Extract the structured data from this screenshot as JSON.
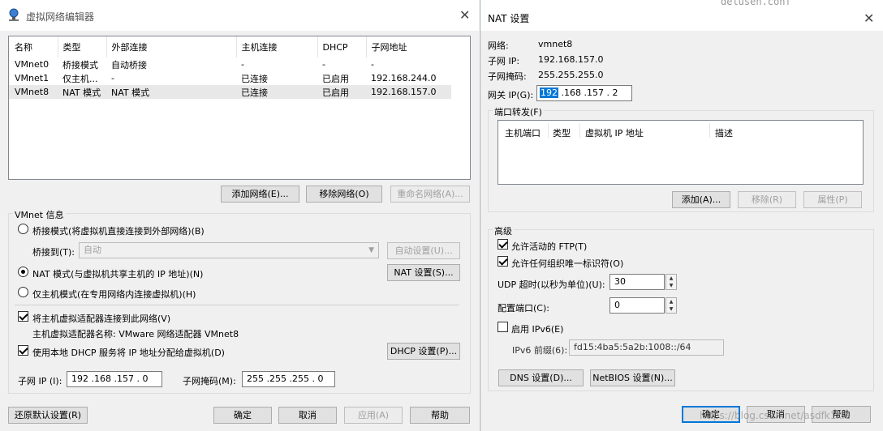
{
  "left": {
    "title": "虚拟网络编辑器",
    "columns": [
      "名称",
      "类型",
      "外部连接",
      "主机连接",
      "DHCP",
      "子网地址"
    ],
    "rows": [
      [
        "VMnet0",
        "桥接模式",
        "自动桥接",
        "-",
        "-",
        "-"
      ],
      [
        "VMnet1",
        "仅主机...",
        "-",
        "已连接",
        "已启用",
        "192.168.244.0"
      ],
      [
        "VMnet8",
        "NAT 模式",
        "NAT 模式",
        "已连接",
        "已启用",
        "192.168.157.0"
      ]
    ],
    "add_network": "添加网络(E)...",
    "remove_network": "移除网络(O)",
    "rename_network": "重命名网络(A)...",
    "vmnet_info": "VMnet 信息",
    "bridge_mode": "桥接模式(将虚拟机直接连接到外部网络)(B)",
    "bridge_to_label": "桥接到(T):",
    "bridge_to_value": "自动",
    "auto_settings": "自动设置(U)...",
    "nat_mode": "NAT 模式(与虚拟机共享主机的 IP 地址)(N)",
    "nat_settings": "NAT 设置(S)...",
    "host_only": "仅主机模式(在专用网络内连接虚拟机)(H)",
    "connect_adapter": "将主机虚拟适配器连接到此网络(V)",
    "adapter_name": "主机虚拟适配器名称: VMware 网络适配器 VMnet8",
    "use_dhcp": "使用本地 DHCP 服务将 IP 地址分配给虚拟机(D)",
    "dhcp_settings": "DHCP 设置(P)...",
    "subnet_ip_label": "子网 IP (I):",
    "subnet_ip": "192 .168 .157 . 0",
    "subnet_mask_label": "子网掩码(M):",
    "subnet_mask": "255 .255 .255 . 0",
    "restore_defaults": "还原默认设置(R)",
    "ok": "确定",
    "cancel": "取消",
    "apply": "应用(A)",
    "help": "帮助"
  },
  "right": {
    "title": "NAT 设置",
    "bg_text": "delusen.conf",
    "network_label": "网络:",
    "network_value": "vmnet8",
    "subnet_ip_label": "子网 IP:",
    "subnet_ip_value": "192.168.157.0",
    "subnet_mask_label": "子网掩码:",
    "subnet_mask_value": "255.255.255.0",
    "gateway_label": "网关 IP(G):",
    "gateway_first": "192",
    "gateway_rest": " .168 .157 . 2",
    "port_forward": "端口转发(F)",
    "pf_columns": [
      "主机端口",
      "类型",
      "虚拟机 IP 地址",
      "描述"
    ],
    "add": "添加(A)...",
    "remove": "移除(R)",
    "properties": "属性(P)",
    "advanced": "高级",
    "allow_ftp": "允许活动的 FTP(T)",
    "allow_org_id": "允许任何组织唯一标识符(O)",
    "udp_timeout_label": "UDP 超时(以秒为单位)(U):",
    "udp_timeout": "30",
    "config_port_label": "配置端口(C):",
    "config_port": "0",
    "enable_ipv6": "启用 IPv6(E)",
    "ipv6_prefix_label": "IPv6 前缀(6):",
    "ipv6_prefix": "fd15:4ba5:5a2b:1008::/64",
    "dns_settings": "DNS 设置(D)...",
    "netbios_settings": "NetBIOS 设置(N)...",
    "ok": "确定",
    "cancel": "取消",
    "help": "帮助",
    "watermark": "https://blog.csdn.net/asdfk1kie"
  }
}
